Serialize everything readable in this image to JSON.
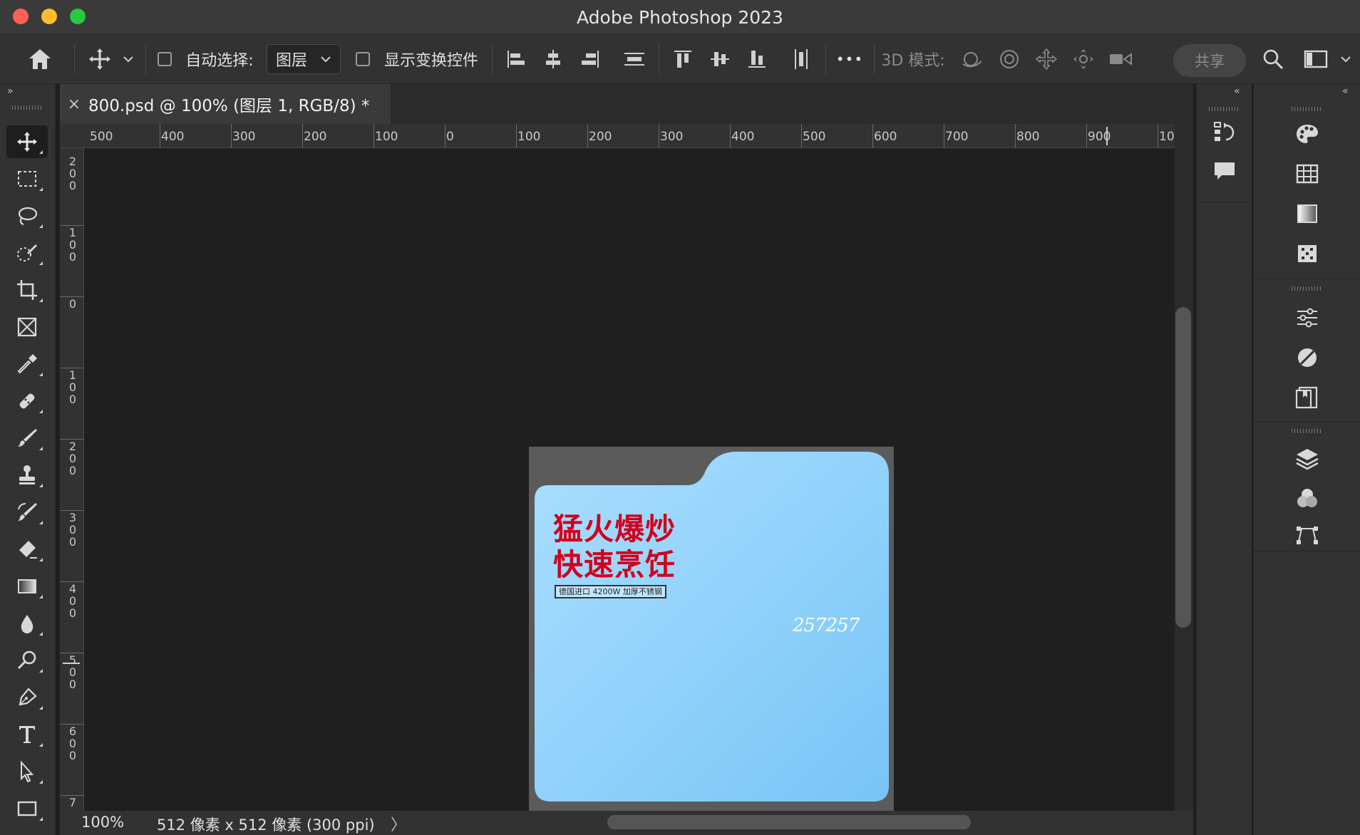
{
  "app": {
    "window_title": "Adobe Photoshop 2023"
  },
  "options_bar": {
    "auto_select_label": "自动选择:",
    "auto_select_target": "图层",
    "show_transform_label": "显示变换控件",
    "more_label": "•••",
    "mode_3d_label": "3D 模式:",
    "share_label": "共享"
  },
  "document": {
    "tab_title": "800.psd @ 100% (图层 1, RGB/8) *",
    "close_glyph": "×"
  },
  "rulers": {
    "top_labels": [
      "500",
      "400",
      "300",
      "200",
      "100",
      "0",
      "100",
      "200",
      "300",
      "400",
      "500",
      "600",
      "700",
      "800",
      "900",
      "10"
    ],
    "left_labels": [
      "200",
      "100",
      "0",
      "100",
      "200",
      "300",
      "400",
      "500",
      "600",
      "7"
    ]
  },
  "artwork": {
    "headline_line1": "猛火爆炒",
    "headline_line2": "快速烹饪",
    "tag": "德国进口 4200W 加厚不锈钢",
    "code": "257257",
    "colors": {
      "folder_top": "#a6dcfd",
      "folder_bottom": "#7ec9f8",
      "headline": "#d1001c",
      "backdrop": "#5b5b5b"
    }
  },
  "status": {
    "zoom": "100%",
    "doc_info": "512 像素 x 512 像素 (300 ppi)",
    "arrow": "〉"
  },
  "tools": [
    "move-tool-icon",
    "rectangular-marquee-icon",
    "lasso-icon",
    "quick-selection-icon",
    "crop-icon",
    "frame-icon",
    "eyedropper-icon",
    "healing-brush-icon",
    "brush-icon",
    "clone-stamp-icon",
    "history-brush-icon",
    "eraser-icon",
    "gradient-icon",
    "blur-icon",
    "dodge-icon",
    "pen-icon",
    "type-icon",
    "path-selection-icon",
    "rectangle-icon"
  ]
}
